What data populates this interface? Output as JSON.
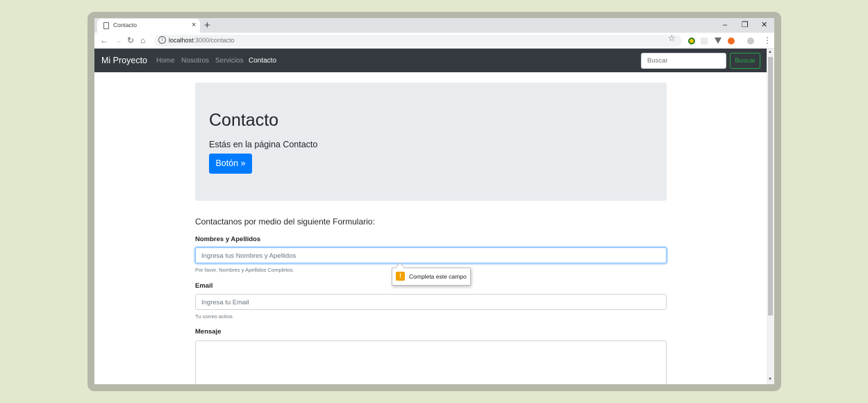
{
  "browser": {
    "tab_title": "Contacto",
    "tab_close": "×",
    "new_tab": "+",
    "url_host": "localhost",
    "url_path": ":3000/contacto",
    "controls": {
      "minimize": "–",
      "restore": "❐",
      "close": "✕"
    }
  },
  "navbar": {
    "brand": "Mi Proyecto",
    "links": [
      "Home",
      "Nosotros",
      "Servicios",
      "Contacto"
    ],
    "search_placeholder": "Buscar",
    "search_button": "Buscar"
  },
  "jumbotron": {
    "title": "Contacto",
    "lead": "Estás en la página Contacto",
    "button": "Botón »"
  },
  "form": {
    "intro": "Contactanos por medio del siguiente Formulario:",
    "name_label": "Nombres y Apellidos",
    "name_placeholder": "Ingresa tus Nombres y Apellidos",
    "name_help": "Por favor, Nombres y Apellidos Completos.",
    "email_label": "Email",
    "email_placeholder": "Ingresa tu Email",
    "email_help": "Tu correo activo.",
    "message_label": "Mensaje"
  },
  "validation_tooltip": {
    "icon": "!",
    "text": "Completa este campo"
  },
  "colors": {
    "navbar_bg": "#343a40",
    "primary": "#007bff",
    "success": "#28a745",
    "jumbotron_bg": "#e9ecef",
    "warning_icon": "#f4a100"
  }
}
